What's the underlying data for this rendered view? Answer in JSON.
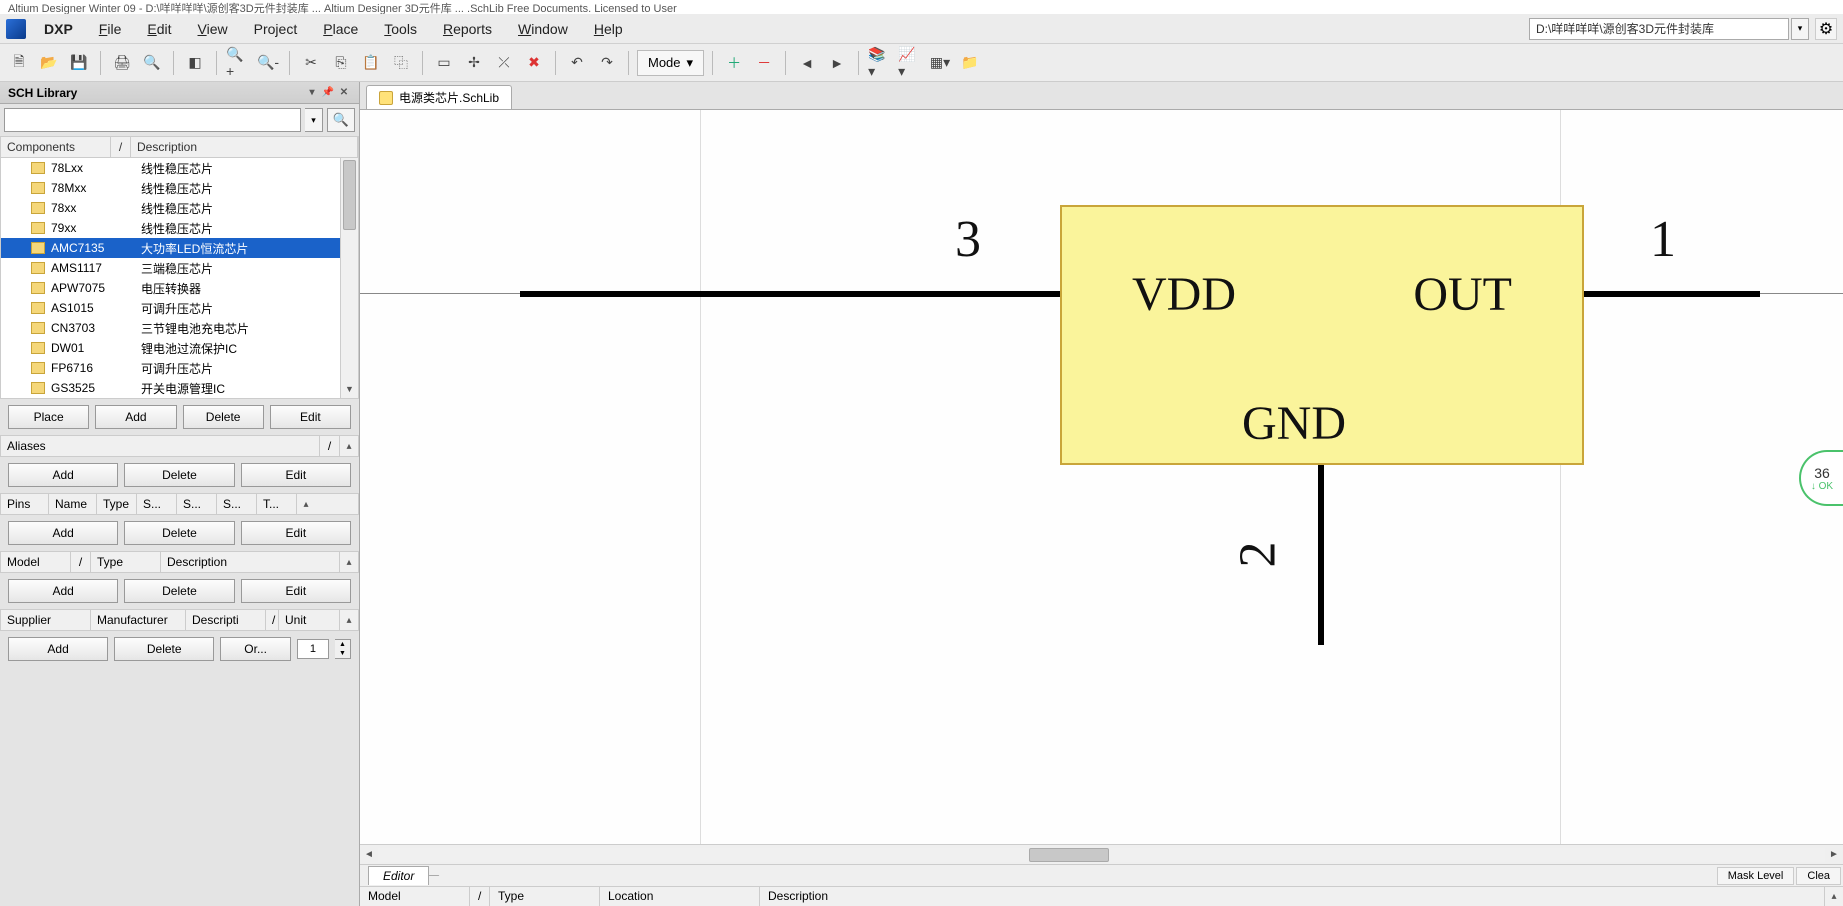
{
  "titlebar": "Altium Designer Winter 09 - D:\\咩咩咩咩\\源创客3D元件封装库 ... Altium Designer 3D元件库 ... .SchLib   Free Documents. Licensed to User",
  "menu": {
    "dxp": "DXP",
    "items": [
      "File",
      "Edit",
      "View",
      "Project",
      "Place",
      "Tools",
      "Reports",
      "Window",
      "Help"
    ],
    "path_box": "D:\\咩咩咩咩\\源创客3D元件封装库"
  },
  "toolbar": {
    "mode_label": "Mode"
  },
  "sch_panel": {
    "title": "SCH Library",
    "cols": {
      "components": "Components",
      "description": "Description"
    },
    "rows": [
      {
        "name": "78Lxx",
        "desc": "线性稳压芯片"
      },
      {
        "name": "78Mxx",
        "desc": "线性稳压芯片"
      },
      {
        "name": "78xx",
        "desc": "线性稳压芯片"
      },
      {
        "name": "79xx",
        "desc": "线性稳压芯片"
      },
      {
        "name": "AMC7135",
        "desc": "大功率LED恒流芯片",
        "selected": true
      },
      {
        "name": "AMS1117",
        "desc": "三端稳压芯片"
      },
      {
        "name": "APW7075",
        "desc": "电压转换器"
      },
      {
        "name": "AS1015",
        "desc": "可调升压芯片"
      },
      {
        "name": "CN3703",
        "desc": "三节锂电池充电芯片"
      },
      {
        "name": "DW01",
        "desc": "锂电池过流保护IC"
      },
      {
        "name": "FP6716",
        "desc": "可调升压芯片"
      },
      {
        "name": "GS3525",
        "desc": "开关电源管理IC"
      }
    ],
    "btns": {
      "place": "Place",
      "add": "Add",
      "delete": "Delete",
      "edit": "Edit",
      "or": "Or..."
    },
    "aliases_label": "Aliases",
    "pins_cols": [
      "Pins",
      "Name",
      "Type",
      "S...",
      "S...",
      "S...",
      "T..."
    ],
    "model_cols": [
      "Model",
      "Type",
      "Description"
    ],
    "supplier_cols": [
      "Supplier",
      "Manufacturer",
      "Descripti",
      "Unit"
    ],
    "order_qty": "1"
  },
  "doc_tab": {
    "label": "电源类芯片.SchLib"
  },
  "schematic": {
    "pin_vdd": "VDD",
    "pin_out": "OUT",
    "pin_gnd": "GND",
    "num1": "1",
    "num2": "2",
    "num3": "3"
  },
  "badge": {
    "value": "36",
    "status": "OK"
  },
  "editor_tab": "Editor",
  "status_btns": {
    "mask": "Mask Level",
    "clear": "Clea"
  },
  "bottom_cols": [
    "Model",
    "Type",
    "Location",
    "Description"
  ]
}
